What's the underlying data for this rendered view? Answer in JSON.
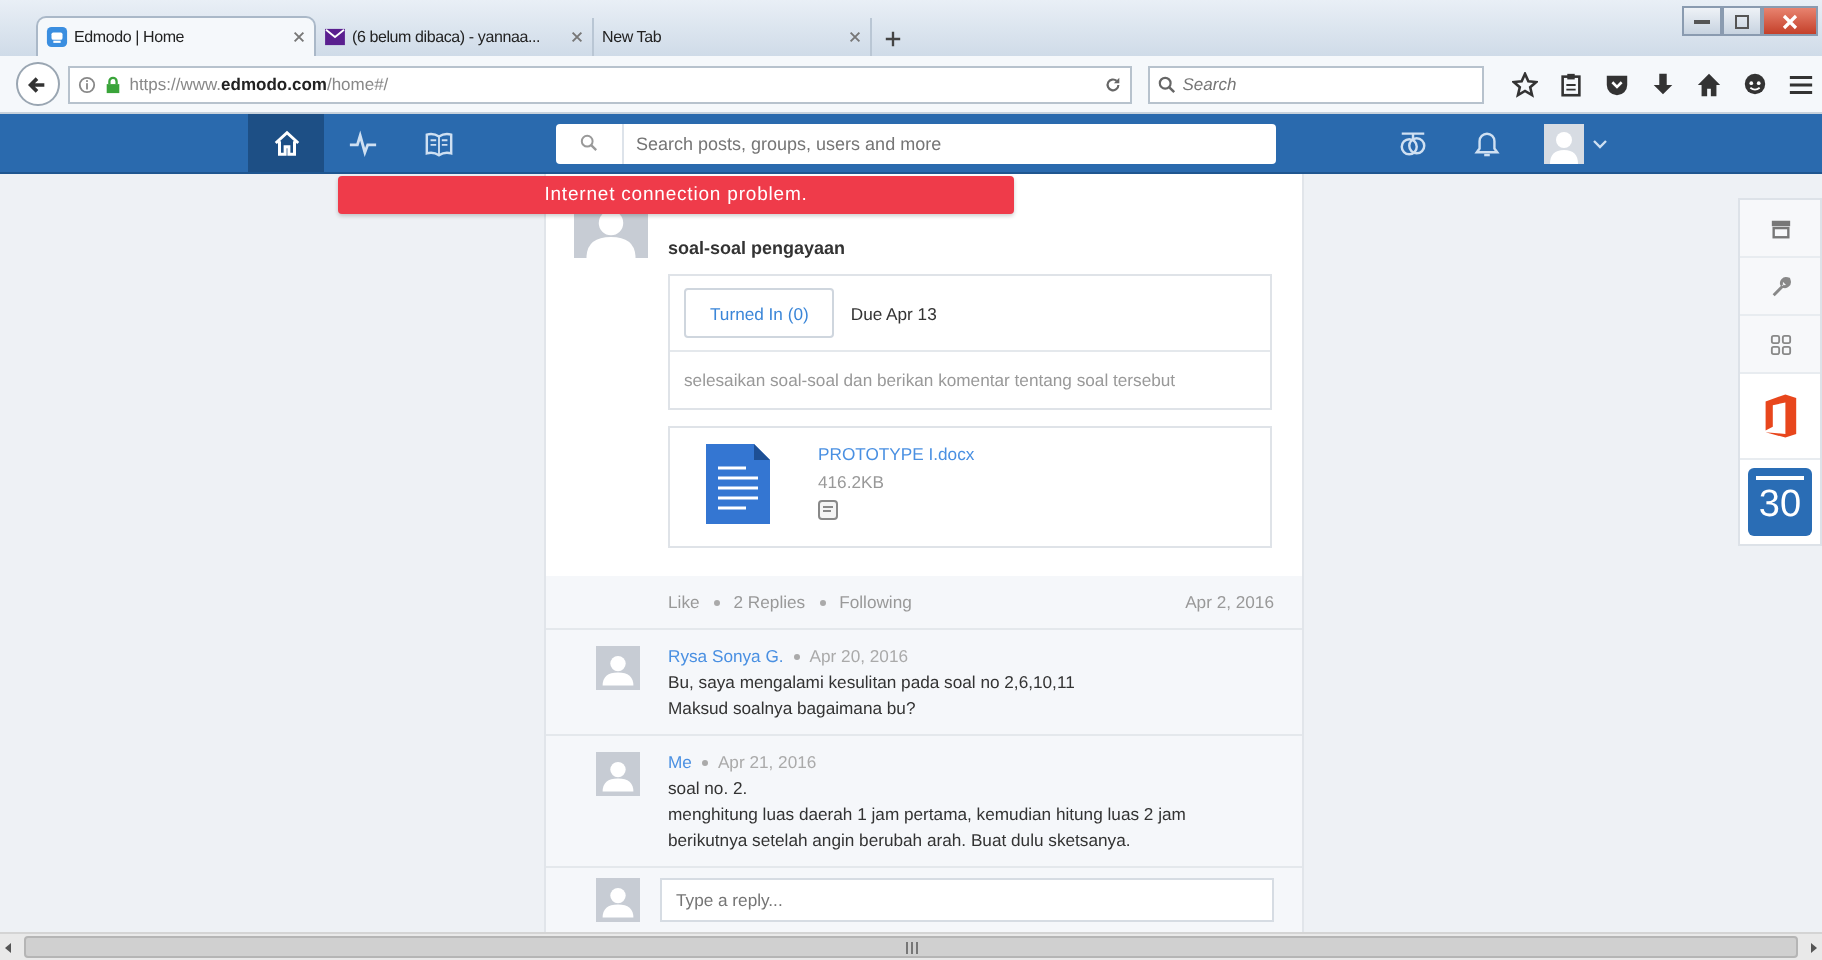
{
  "browser": {
    "tabs": [
      {
        "title": "Edmodo | Home",
        "kind": "edmodo",
        "selected": true
      },
      {
        "title": "(6 belum dibaca) - yannaa...",
        "kind": "mail",
        "selected": false
      },
      {
        "title": "New Tab",
        "kind": "blank",
        "selected": false
      }
    ],
    "url": {
      "prefix": "https://www.",
      "domain": "edmodo.com",
      "path": "/home#/"
    },
    "search": {
      "placeholder": "Search"
    }
  },
  "nav": {
    "items": [
      {
        "kind": "home",
        "selected": true
      },
      {
        "kind": "pulse",
        "selected": false
      },
      {
        "kind": "library",
        "selected": false
      }
    ],
    "search": {
      "placeholder": "Search posts, groups, users and more"
    }
  },
  "alert": "Internet connection problem.",
  "post": {
    "title": "soal-soal pengayaan",
    "turned_in": "Turned In (0)",
    "due": "Due Apr 13",
    "description": "selesaikan soal-soal dan berikan komentar tentang soal tersebut",
    "attachment": {
      "name": "PROTOTYPE I.docx",
      "size": "416.2KB"
    },
    "actions": [
      "Like",
      "2 Replies",
      "Following"
    ],
    "date": "Apr 2, 2016"
  },
  "comments": [
    {
      "author": "Rysa Sonya G.",
      "date": "Apr 20, 2016",
      "lines": [
        "Bu, saya mengalami kesulitan pada soal no 2,6,10,11",
        "Maksud soalnya bagaimana bu?"
      ]
    },
    {
      "author": "Me",
      "date": "Apr 21, 2016",
      "lines": [
        "soal no. 2.",
        "menghitung luas daerah 1 jam pertama, kemudian hitung luas 2 jam",
        "berikutnya setelah angin berubah arah. Buat dulu sketsanya."
      ]
    }
  ],
  "reply": {
    "placeholder": "Type a reply..."
  },
  "side_panel": {
    "items": [
      {
        "kind": "store"
      },
      {
        "kind": "tools"
      },
      {
        "kind": "apps"
      },
      {
        "kind": "office"
      },
      {
        "kind": "calendar",
        "label": "30"
      }
    ]
  }
}
